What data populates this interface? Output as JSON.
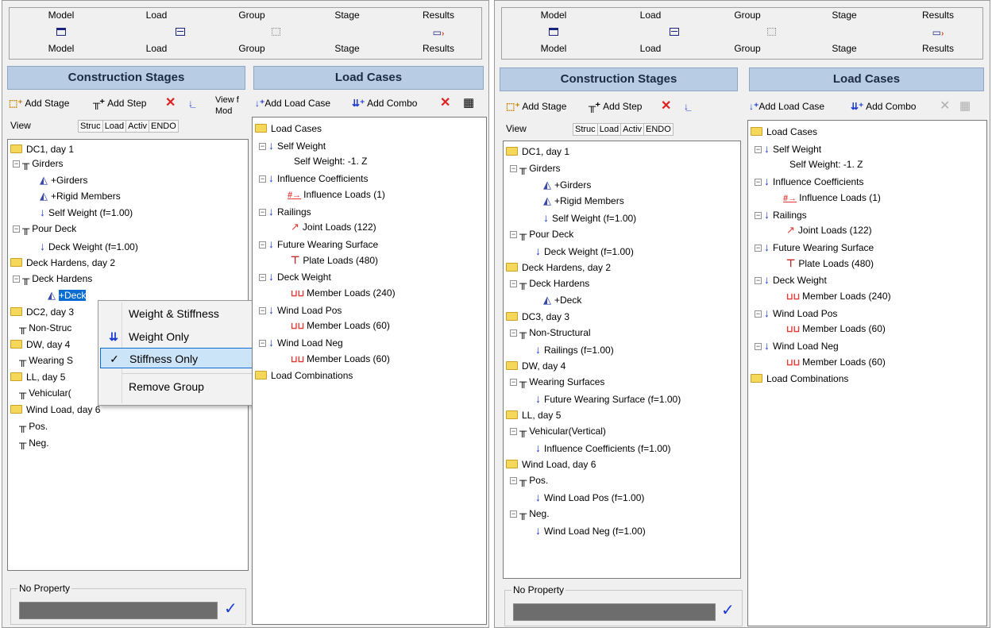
{
  "tabs": [
    {
      "top": "Model",
      "bottom": "Model",
      "icon": "model-window-icon"
    },
    {
      "top": "Load",
      "bottom": "Load",
      "icon": "load-window-icon"
    },
    {
      "top": "Group",
      "bottom": "Group",
      "icon": "group-window-icon"
    },
    {
      "top": "Stage",
      "bottom": "Stage",
      "icon": "stage-window-icon"
    },
    {
      "top": "Results",
      "bottom": "Results",
      "icon": "results-window-icon"
    }
  ],
  "construction_stages": {
    "title": "Construction Stages",
    "add_stage": "Add Stage",
    "add_step": "Add Step",
    "view_label": "View",
    "view_tabs": [
      "Struc",
      "Load",
      "Activ",
      "ENDO"
    ]
  },
  "load_cases": {
    "title": "Load Cases",
    "add_load_case": "Add Load Case",
    "add_combo": "Add Combo",
    "cut_view": "View f",
    "cut_mod": "Mod"
  },
  "left_stages": [
    "DC1, day 1",
    "Girders",
    "+Girders",
    "+Rigid Members",
    "Self Weight (f=1.00)",
    "Pour Deck",
    "Deck Weight (f=1.00)",
    "Deck Hardens, day 2",
    "Deck Hardens",
    "+Deck",
    "DC2, day 3",
    "Non-Struc",
    "DW, day 4",
    "Wearing S",
    "LL, day 5",
    "Vehicular(",
    "Wind Load, day 6",
    "Pos.",
    "Neg."
  ],
  "right_stages": [
    "DC1, day 1",
    "Girders",
    "+Girders",
    "+Rigid Members",
    "Self Weight (f=1.00)",
    "Pour Deck",
    "Deck Weight (f=1.00)",
    "Deck Hardens, day 2",
    "Deck Hardens",
    "+Deck",
    "DC3, day 3",
    "Non-Structural",
    "Railings (f=1.00)",
    "DW, day 4",
    "Wearing Surfaces",
    "Future Wearing Surface (f=1.00)",
    "LL, day 5",
    "Vehicular(Vertical)",
    "Influence Coefficients (f=1.00)",
    "Wind Load, day 6",
    "Pos.",
    "Wind Load Pos (f=1.00)",
    "Neg.",
    "Wind Load Neg (f=1.00)"
  ],
  "load_tree": [
    "Load Cases",
    "Self Weight",
    "Self Weight: -1. Z",
    "Influence Coefficients",
    "Influence Loads (1)",
    "Railings",
    "Joint Loads (122)",
    "Future Wearing Surface",
    "Plate Loads (480)",
    "Deck Weight",
    "Member Loads (240)",
    "Wind Load Pos",
    "Member Loads (60)",
    "Wind Load Neg",
    "Member Loads (60)",
    "Load Combinations"
  ],
  "context_menu": {
    "items": [
      "Weight & Stiffness",
      "Weight Only",
      "Stiffness Only",
      "Remove Group"
    ],
    "checked": "Stiffness Only"
  },
  "property": {
    "label": "No Property"
  },
  "colors": {
    "header_bg": "#b8cce4",
    "selection": "#0a6cd1",
    "accent_blue": "#1a3ad1"
  }
}
